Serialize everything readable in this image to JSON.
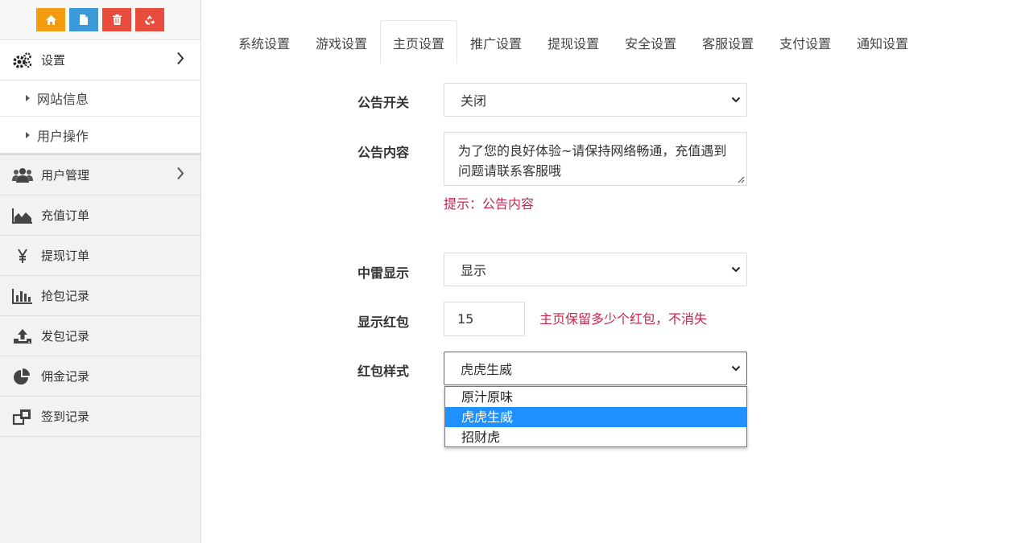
{
  "toolbar": {
    "icons": [
      "home-icon",
      "file-icon",
      "trash-icon",
      "recycle-icon"
    ],
    "colors": [
      "#f39c12",
      "#3a9ad9",
      "#e74c3c",
      "#e74c3c"
    ]
  },
  "sidebar": {
    "settings_label": "设置",
    "sub_items": [
      "网站信息",
      "用户操作"
    ],
    "items": [
      {
        "label": "用户管理",
        "icon": "users-icon"
      },
      {
        "label": "充值订单",
        "icon": "area-chart-icon"
      },
      {
        "label": "提现订单",
        "icon": "yen-icon"
      },
      {
        "label": "抢包记录",
        "icon": "bar-chart-icon"
      },
      {
        "label": "发包记录",
        "icon": "upload-icon"
      },
      {
        "label": "佣金记录",
        "icon": "pie-chart-icon"
      },
      {
        "label": "签到记录",
        "icon": "clone-icon"
      }
    ]
  },
  "tabs": [
    "系统设置",
    "游戏设置",
    "主页设置",
    "推广设置",
    "提现设置",
    "安全设置",
    "客服设置",
    "支付设置",
    "通知设置"
  ],
  "active_tab": "主页设置",
  "form": {
    "notice_switch_label": "公告开关",
    "notice_switch_value": "关闭",
    "notice_content_label": "公告内容",
    "notice_content_value": "为了您的良好体验~请保持网络畅通，充值遇到问题请联系客服哦",
    "notice_hint": "提示：公告内容",
    "mine_display_label": "中雷显示",
    "mine_display_value": "显示",
    "show_packets_label": "显示红包",
    "show_packets_value": "15",
    "show_packets_hint": "主页保留多少个红包，不消失",
    "packet_style_label": "红包样式",
    "packet_style_value": "虎虎生威",
    "packet_style_options": [
      "原汁原味",
      "虎虎生威",
      "招财虎"
    ]
  },
  "colors": {
    "hint": "#c7254e",
    "selected_option": "#1e90ff"
  }
}
